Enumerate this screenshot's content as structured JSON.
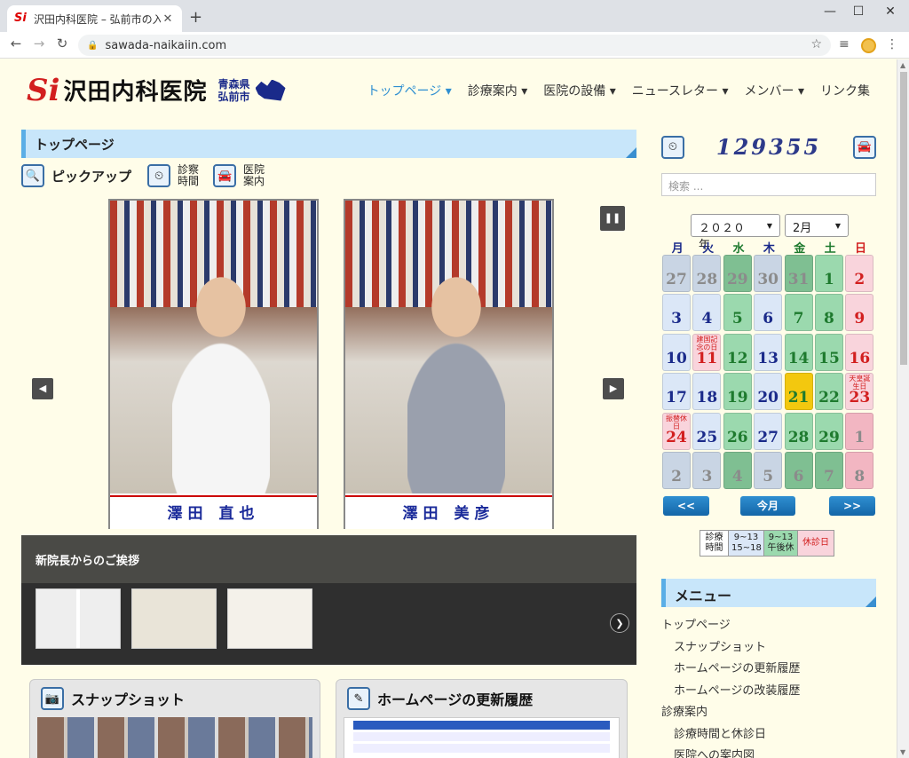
{
  "browser": {
    "tab_title": "沢田内科医院 – 弘前市の入院診療",
    "url": "sawada-naikaiin.com"
  },
  "site": {
    "logo_text": "沢田内科医院",
    "logo_mark": "Si",
    "prefecture": "青森県",
    "city": "弘前市"
  },
  "nav": [
    {
      "label": "トップページ",
      "has_caret": true,
      "active": true
    },
    {
      "label": "診療案内",
      "has_caret": true
    },
    {
      "label": "医院の設備",
      "has_caret": true
    },
    {
      "label": "ニュースレター",
      "has_caret": true
    },
    {
      "label": "メンバー",
      "has_caret": true
    },
    {
      "label": "リンク集",
      "has_caret": false
    }
  ],
  "section_title": "トップページ",
  "pickup": {
    "label": "ピックアップ",
    "links": [
      {
        "line1": "診察",
        "line2": "時間"
      },
      {
        "line1": "医院",
        "line2": "案内"
      }
    ]
  },
  "slides": [
    {
      "caption": "澤田 直也"
    },
    {
      "caption": "澤田 美彦"
    }
  ],
  "gallery": {
    "title": "新院長からのご挨拶"
  },
  "cards": [
    {
      "title": "スナップショット"
    },
    {
      "title": "ホームページの更新履歴"
    }
  ],
  "counter": {
    "value": "129355"
  },
  "search": {
    "placeholder": "検索 ..."
  },
  "calendar": {
    "year": "２０２０年",
    "month": "2月",
    "weekdays": [
      "月",
      "火",
      "水",
      "木",
      "金",
      "土",
      "日"
    ],
    "weekday_colors": [
      "#1a2a8a",
      "#1a2a8a",
      "#1e7a2e",
      "#1a2a8a",
      "#1e7a2e",
      "#1e7a2e",
      "#d21f1f"
    ],
    "weeks": [
      [
        {
          "d": "27",
          "t": "o"
        },
        {
          "d": "28",
          "t": "o"
        },
        {
          "d": "29",
          "t": "og"
        },
        {
          "d": "30",
          "t": "o"
        },
        {
          "d": "31",
          "t": "og"
        },
        {
          "d": "1",
          "t": "g"
        },
        {
          "d": "2",
          "t": "r"
        }
      ],
      [
        {
          "d": "3",
          "t": "b"
        },
        {
          "d": "4",
          "t": "b"
        },
        {
          "d": "5",
          "t": "g"
        },
        {
          "d": "6",
          "t": "b"
        },
        {
          "d": "7",
          "t": "g"
        },
        {
          "d": "8",
          "t": "g"
        },
        {
          "d": "9",
          "t": "r"
        }
      ],
      [
        {
          "d": "10",
          "t": "b"
        },
        {
          "d": "11",
          "t": "r",
          "note": "建国記念の日"
        },
        {
          "d": "12",
          "t": "g"
        },
        {
          "d": "13",
          "t": "b"
        },
        {
          "d": "14",
          "t": "g"
        },
        {
          "d": "15",
          "t": "g"
        },
        {
          "d": "16",
          "t": "r"
        }
      ],
      [
        {
          "d": "17",
          "t": "b"
        },
        {
          "d": "18",
          "t": "b"
        },
        {
          "d": "19",
          "t": "g"
        },
        {
          "d": "20",
          "t": "b"
        },
        {
          "d": "21",
          "t": "today"
        },
        {
          "d": "22",
          "t": "g"
        },
        {
          "d": "23",
          "t": "r",
          "note": "天皇誕生日"
        }
      ],
      [
        {
          "d": "24",
          "t": "r",
          "note": "振替休日"
        },
        {
          "d": "25",
          "t": "b"
        },
        {
          "d": "26",
          "t": "g"
        },
        {
          "d": "27",
          "t": "b"
        },
        {
          "d": "28",
          "t": "g"
        },
        {
          "d": "29",
          "t": "g"
        },
        {
          "d": "1",
          "t": "or"
        }
      ],
      [
        {
          "d": "2",
          "t": "o"
        },
        {
          "d": "3",
          "t": "o"
        },
        {
          "d": "4",
          "t": "og"
        },
        {
          "d": "5",
          "t": "o"
        },
        {
          "d": "6",
          "t": "og"
        },
        {
          "d": "7",
          "t": "og"
        },
        {
          "d": "8",
          "t": "or"
        }
      ]
    ],
    "prev_label": "<<",
    "today_label": "今月",
    "next_label": ">>"
  },
  "legend": {
    "label": "診療時間",
    "normal": "9~13 15~18",
    "half": "9~13 午後休",
    "closed": "休診日"
  },
  "side_menu": {
    "title": "メニュー",
    "items": [
      {
        "label": "トップページ",
        "sub": false
      },
      {
        "label": "スナップショット",
        "sub": true
      },
      {
        "label": "ホームページの更新履歴",
        "sub": true
      },
      {
        "label": "ホームページの改装履歴",
        "sub": true
      },
      {
        "label": "診療案内",
        "sub": false
      },
      {
        "label": "診療時間と休診日",
        "sub": true
      },
      {
        "label": "医院への案内図",
        "sub": true
      }
    ]
  }
}
